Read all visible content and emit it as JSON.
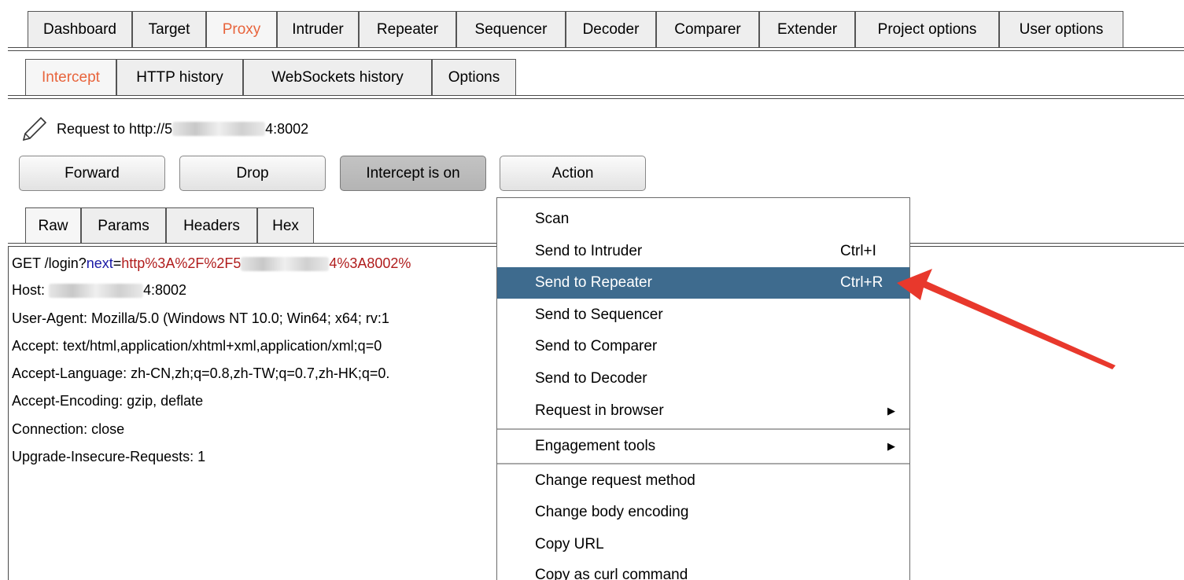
{
  "main_tabs": [
    {
      "label": "Dashboard",
      "active": false
    },
    {
      "label": "Target",
      "active": false
    },
    {
      "label": "Proxy",
      "active": true
    },
    {
      "label": "Intruder",
      "active": false
    },
    {
      "label": "Repeater",
      "active": false
    },
    {
      "label": "Sequencer",
      "active": false
    },
    {
      "label": "Decoder",
      "active": false
    },
    {
      "label": "Comparer",
      "active": false
    },
    {
      "label": "Extender",
      "active": false
    },
    {
      "label": "Project options",
      "active": false
    },
    {
      "label": "User options",
      "active": false
    }
  ],
  "proxy_tabs": [
    {
      "label": "Intercept",
      "active": true
    },
    {
      "label": "HTTP history",
      "active": false
    },
    {
      "label": "WebSockets history",
      "active": false
    },
    {
      "label": "Options",
      "active": false
    }
  ],
  "request": {
    "target_prefix": "Request to http://5",
    "target_suffix": "4:8002"
  },
  "buttons": {
    "forward": "Forward",
    "drop": "Drop",
    "intercept": "Intercept is on",
    "action": "Action"
  },
  "editor_tabs": [
    {
      "label": "Raw",
      "active": true
    },
    {
      "label": "Params",
      "active": false
    },
    {
      "label": "Headers",
      "active": false
    },
    {
      "label": "Hex",
      "active": false
    }
  ],
  "raw": {
    "line1": {
      "method": "GET /login?",
      "param": "next",
      "eq": "=",
      "val_prefix": "http%3A%2F%2F5",
      "val_suffix": "4%3A8002%"
    },
    "host_prefix": "Host: ",
    "host_suffix": "4:8002",
    "headers": [
      "User-Agent: Mozilla/5.0 (Windows NT 10.0; Win64; x64; rv:1",
      "Accept: text/html,application/xhtml+xml,application/xml;q=0",
      "Accept-Language: zh-CN,zh;q=0.8,zh-TW;q=0.7,zh-HK;q=0.",
      "Accept-Encoding: gzip, deflate",
      "Connection: close",
      "Upgrade-Insecure-Requests: 1"
    ]
  },
  "context_menu": {
    "items": [
      {
        "label": "Scan",
        "shortcut": ""
      },
      {
        "label": "Send to Intruder",
        "shortcut": "Ctrl+I"
      },
      {
        "label": "Send to Repeater",
        "shortcut": "Ctrl+R",
        "highlighted": true
      },
      {
        "label": "Send to Sequencer",
        "shortcut": ""
      },
      {
        "label": "Send to Comparer",
        "shortcut": ""
      },
      {
        "label": "Send to Decoder",
        "shortcut": ""
      },
      {
        "label": "Request in browser",
        "shortcut": "",
        "submenu": true
      },
      {
        "label": "Engagement tools",
        "shortcut": "",
        "submenu": true
      },
      {
        "label": "Change request method",
        "shortcut": ""
      },
      {
        "label": "Change body encoding",
        "shortcut": ""
      },
      {
        "label": "Copy URL",
        "shortcut": ""
      },
      {
        "label": "Copy as curl command",
        "shortcut": ""
      }
    ],
    "submenu_glyph": "▶"
  },
  "colors": {
    "accent_tab": "#e8643c",
    "menu_highlight": "#3e6b8e",
    "arrow": "#e8382c",
    "param_name": "#1a1aa6",
    "param_value": "#b01c1c"
  }
}
